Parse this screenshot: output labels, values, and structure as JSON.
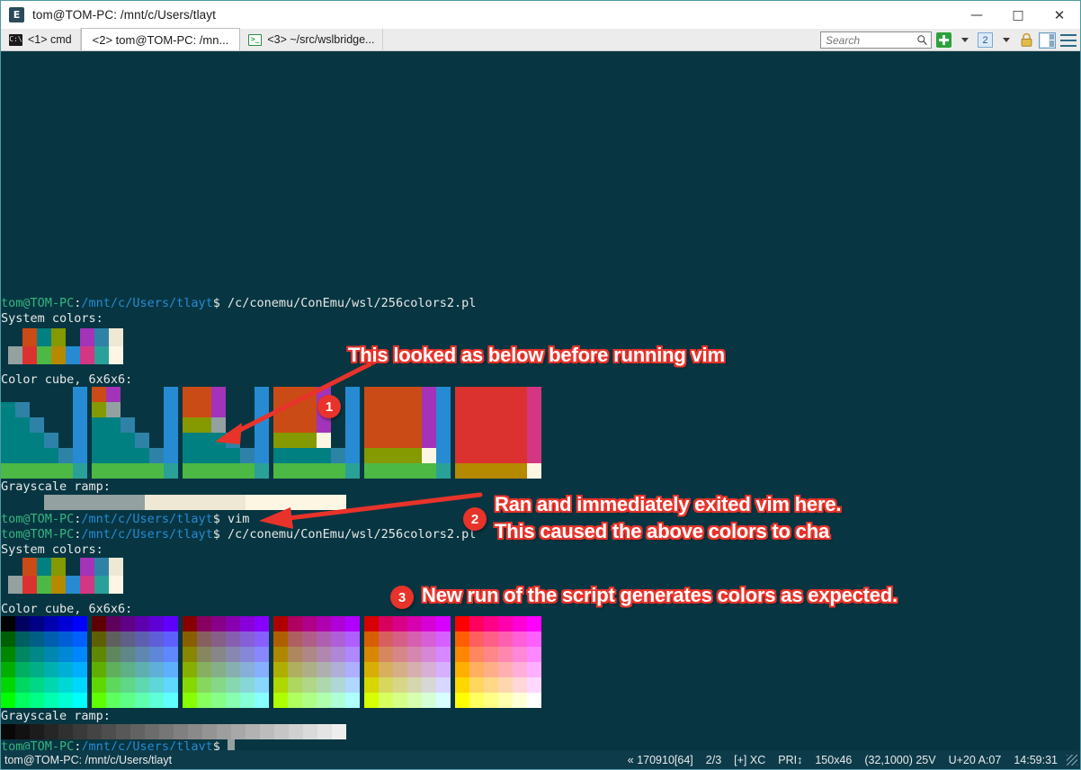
{
  "window": {
    "title": "tom@TOM-PC: /mnt/c/Users/tlayt",
    "icon": "conemu-icon",
    "minimize_label": "—",
    "maximize_label": "□",
    "close_label": "✕"
  },
  "tabs": [
    {
      "label": "<1> cmd",
      "icon": "cmd-console-icon",
      "active": false
    },
    {
      "label": "<2> tom@TOM-PC: /mn...",
      "icon": "none",
      "active": true
    },
    {
      "label": "<3> ~/src/wslbridge...",
      "icon": "wsl-console-icon",
      "active": false
    }
  ],
  "toolbar": {
    "search_placeholder": "Search",
    "search_value": "",
    "search_icon": "magnifier-icon",
    "new_console_icon": "green-plus-icon",
    "new_console_caret": "chevron-down-icon",
    "active_count": "2",
    "active_count_caret": "chevron-down-icon",
    "lock_icon": "padlock-icon",
    "split_icon": "split-panes-icon",
    "menu_icon": "hamburger-menu-icon"
  },
  "terminal": {
    "background": "#073642",
    "prompt_user_host": "tom@TOM-PC",
    "prompt_colon": ":",
    "prompt_path": "/mnt/c/Users/tlayt",
    "prompt_sigil": "$",
    "lines": [
      {
        "type": "prompt",
        "command": " /c/conemu/ConEmu/wsl/256colors2.pl"
      },
      {
        "type": "text",
        "text": "System colors:"
      },
      {
        "type": "palette",
        "id": "system-colors-corrupt"
      },
      {
        "type": "text",
        "text": "Color cube, 6x6x6:"
      },
      {
        "type": "cube",
        "id": "color-cube-corrupt"
      },
      {
        "type": "text",
        "text": "Grayscale ramp:"
      },
      {
        "type": "ramp",
        "id": "grayscale-ramp-corrupt"
      },
      {
        "type": "prompt",
        "command": " vim"
      },
      {
        "type": "prompt",
        "command": " /c/conemu/ConEmu/wsl/256colors2.pl"
      },
      {
        "type": "text",
        "text": "System colors:"
      },
      {
        "type": "palette",
        "id": "system-colors-good"
      },
      {
        "type": "text",
        "text": "Color cube, 6x6x6:"
      },
      {
        "type": "cube",
        "id": "color-cube-good"
      },
      {
        "type": "text",
        "text": "Grayscale ramp:"
      },
      {
        "type": "ramp",
        "id": "grayscale-ramp-good"
      },
      {
        "type": "prompt",
        "command": "",
        "cursor": true
      }
    ],
    "system_colors_row1": [
      "#073642",
      "#cb4b16",
      "#008080",
      "#859900",
      "#073642",
      "#a333b8",
      "#2e82a8",
      "#eee8d5"
    ],
    "system_colors_row2": [
      "#93a1a1",
      "#dc322f",
      "#4cb944",
      "#b58900",
      "#268bd2",
      "#d33682",
      "#2aa198",
      "#fdf6e3"
    ],
    "grayscale_corrupt": [
      "#93a1a1",
      "#eee8d5",
      "#fdf6e3"
    ],
    "grayscale_good": [
      "#080808",
      "#121212",
      "#1c1c1c",
      "#262626",
      "#303030",
      "#3a3a3a",
      "#444444",
      "#4e4e4e",
      "#585858",
      "#626262",
      "#6c6c6c",
      "#767676",
      "#808080",
      "#8a8a8a",
      "#949494",
      "#9e9e9e",
      "#a8a8a8",
      "#b2b2b2",
      "#bcbcbc",
      "#c6c6c6",
      "#d0d0d0",
      "#dadada",
      "#e4e4e4",
      "#eeeeee"
    ]
  },
  "annotations": [
    {
      "number": "1",
      "lines": [
        "This looked as below before running vim"
      ],
      "arrow": "points-to-first-color-cube"
    },
    {
      "number": "2",
      "lines": [
        "Ran and immediately exited vim here.",
        "This caused the above colors to cha"
      ],
      "arrow": "points-to-vim-command"
    },
    {
      "number": "3",
      "lines": [
        "New run of the script generates colors as expected."
      ],
      "arrow": "none"
    }
  ],
  "statusbar": {
    "path": "tom@TOM-PC: /mnt/c/Users/tlayt",
    "fields": [
      "« 170910[64]",
      "2/3",
      "[+] XC",
      "PRI↕",
      "150x46",
      "(32,1000) 25V",
      "U+20 A:07",
      "14:59:31"
    ]
  },
  "colors": {
    "accent_red": "#e8332a",
    "terminal_bg": "#073642",
    "statusbar_bg": "#0d3b4a",
    "window_border": "#4e9ba6"
  }
}
